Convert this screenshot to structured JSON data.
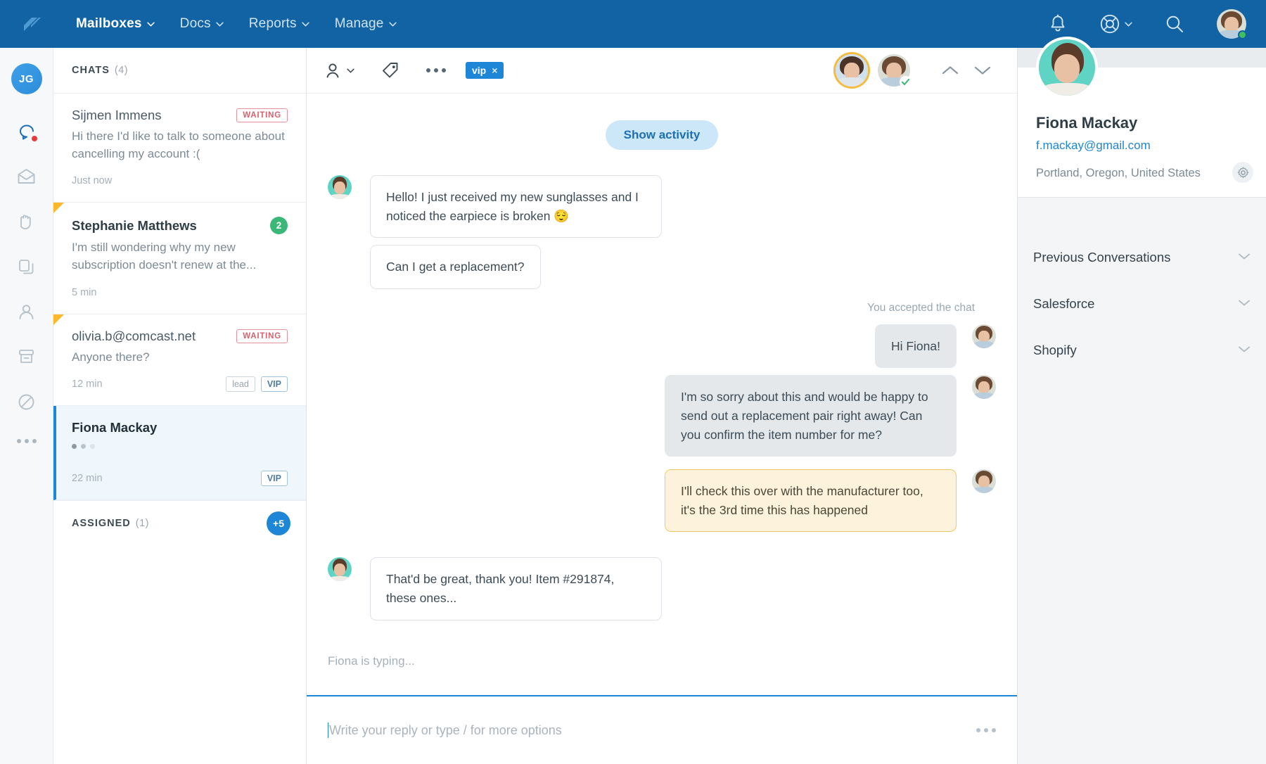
{
  "topnav": {
    "logo_name": "helpscout-logo",
    "items": [
      {
        "label": "Mailboxes",
        "active": true
      },
      {
        "label": "Docs",
        "active": false
      },
      {
        "label": "Reports",
        "active": false
      },
      {
        "label": "Manage",
        "active": false
      }
    ],
    "icons": [
      "bell-icon",
      "lifebuoy-help-icon",
      "search-icon"
    ],
    "user_avatar_alt": "current-user-avatar",
    "user_status": "online",
    "bg_color": "#1163a3"
  },
  "rail": {
    "user_initials": "JG",
    "items": [
      {
        "icon": "chat-bubble-icon",
        "active": true,
        "has_badge": true
      },
      {
        "icon": "open-envelope-icon",
        "active": false,
        "has_badge": false
      },
      {
        "icon": "raised-hand-icon",
        "active": false,
        "has_badge": false
      },
      {
        "icon": "copy-pages-icon",
        "active": false,
        "has_badge": false
      },
      {
        "icon": "person-icon",
        "active": false,
        "has_badge": false
      },
      {
        "icon": "archive-box-icon",
        "active": false,
        "has_badge": false
      },
      {
        "icon": "no-entry-spam-icon",
        "active": false,
        "has_badge": false
      }
    ],
    "more_icon": "more-dots-icon"
  },
  "chat_list": {
    "header": {
      "title": "CHATS",
      "count": "(4)"
    },
    "items": [
      {
        "name": "Sijmen Immens",
        "preview": "Hi there I'd like to talk to someone about cancelling my account :(",
        "time": "Just now",
        "status_badge": "WAITING",
        "unread": null,
        "tags": [],
        "flagged": false,
        "selected": false,
        "typing": false
      },
      {
        "name": "Stephanie Matthews",
        "preview": "I'm still wondering why my new subscription doesn't renew at the...",
        "time": "5 min",
        "status_badge": null,
        "unread": "2",
        "tags": [],
        "flagged": true,
        "selected": false,
        "typing": false
      },
      {
        "name": "olivia.b@comcast.net",
        "preview": "Anyone there?",
        "time": "12 min",
        "status_badge": "WAITING",
        "unread": null,
        "tags": [
          "lead",
          "VIP"
        ],
        "flagged": true,
        "selected": false,
        "typing": false
      },
      {
        "name": "Fiona Mackay",
        "preview": "",
        "time": "22 min",
        "status_badge": null,
        "unread": null,
        "tags": [
          "VIP"
        ],
        "flagged": false,
        "selected": true,
        "typing": true
      }
    ],
    "assigned": {
      "title": "ASSIGNED",
      "count": "(1)",
      "badge": "+5"
    }
  },
  "conversation": {
    "toolbar": {
      "assign_icon": "assign-person-icon",
      "tag_icon": "tag-icon",
      "more_icon": "more-dots-icon",
      "tag_chip": {
        "label": "vip",
        "remove": "×"
      },
      "up_icon": "chevron-up-icon",
      "down_icon": "chevron-down-icon",
      "avatar1_alt": "active-agent-avatar",
      "avatar2_alt": "agent-avatar-accepted"
    },
    "activity_button": "Show activity",
    "messages": [
      {
        "dir": "in",
        "kind": "bubble",
        "text": "Hello! I just received my new sunglasses and I noticed the earpiece is broken 😌",
        "avatar": true
      },
      {
        "dir": "in",
        "kind": "bubble",
        "text": "Can I get a replacement?",
        "avatar": false
      },
      {
        "dir": "sys",
        "kind": "system",
        "text": "You accepted the chat"
      },
      {
        "dir": "out",
        "kind": "bubble",
        "text": "Hi Fiona!",
        "avatar": true
      },
      {
        "dir": "out",
        "kind": "bubble",
        "text": "I'm so sorry about this and would be happy to send out a replacement pair right away! Can you confirm the item number for me?",
        "avatar": true
      },
      {
        "dir": "out",
        "kind": "note",
        "text": "I'll check this over with the manufacturer too, it's the 3rd time this has happened",
        "avatar": true
      },
      {
        "dir": "in",
        "kind": "bubble",
        "text": "That'd be great, thank you! Item #291874, these ones...",
        "avatar": true
      }
    ],
    "typing_indicator": "Fiona is typing...",
    "reply_placeholder": "Write your reply or type / for more options",
    "reply_more_icon": "more-dots-icon"
  },
  "side_panel": {
    "socials": [
      "chat-monitor-icon",
      "facebook-icon",
      "twitter-icon"
    ],
    "profile": {
      "avatar_alt": "fiona-mackay-avatar",
      "name": "Fiona Mackay",
      "email": "f.mackay@gmail.com",
      "location": "Portland, Oregon, United States",
      "settings_icon": "gear-icon"
    },
    "sections": [
      {
        "label": "Previous Conversations",
        "chevron": "chevron-down-icon"
      },
      {
        "label": "Salesforce",
        "chevron": "chevron-down-icon"
      },
      {
        "label": "Shopify",
        "chevron": "chevron-down-icon"
      }
    ]
  },
  "colors": {
    "brand_blue": "#1163a3",
    "accent_blue": "#1e86d6",
    "waiting_red": "#d9616f",
    "unread_green": "#3bb878",
    "note_yellow": "#fdf3dd",
    "flag_orange": "#f9b92b"
  }
}
